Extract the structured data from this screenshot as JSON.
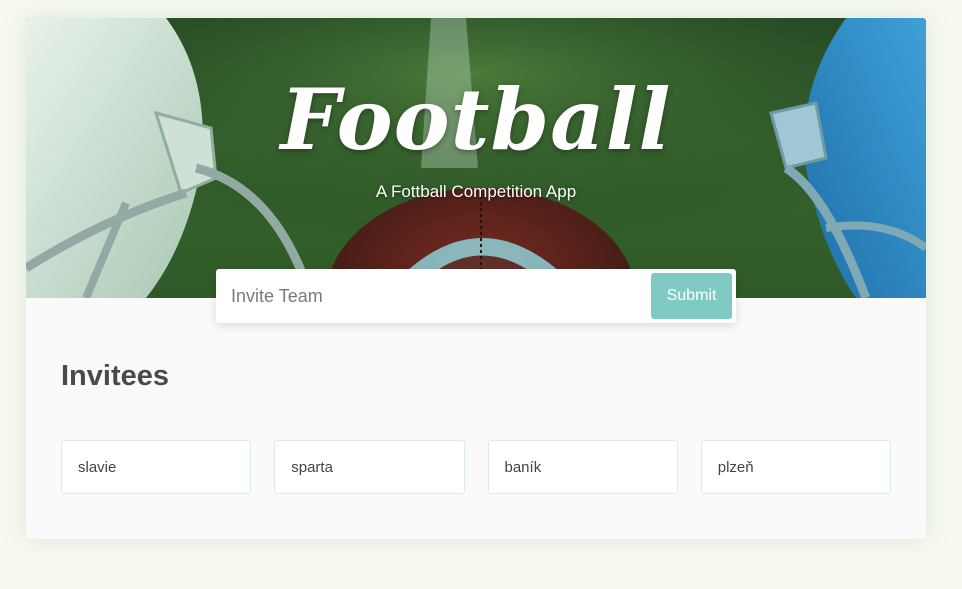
{
  "hero": {
    "title": "Football",
    "subtitle": "A Fottball Competition App"
  },
  "invite": {
    "placeholder": "Invite Team",
    "value": "",
    "submit_label": "Submit"
  },
  "invitees": {
    "heading": "Invitees",
    "items": [
      "slavie",
      "sparta",
      "baník",
      "plzeň"
    ]
  },
  "colors": {
    "page_background": "#f6faf0",
    "card_background": "#fafafa",
    "submit_button": "#7fcbc4",
    "heading_text": "#4a4a4a"
  }
}
